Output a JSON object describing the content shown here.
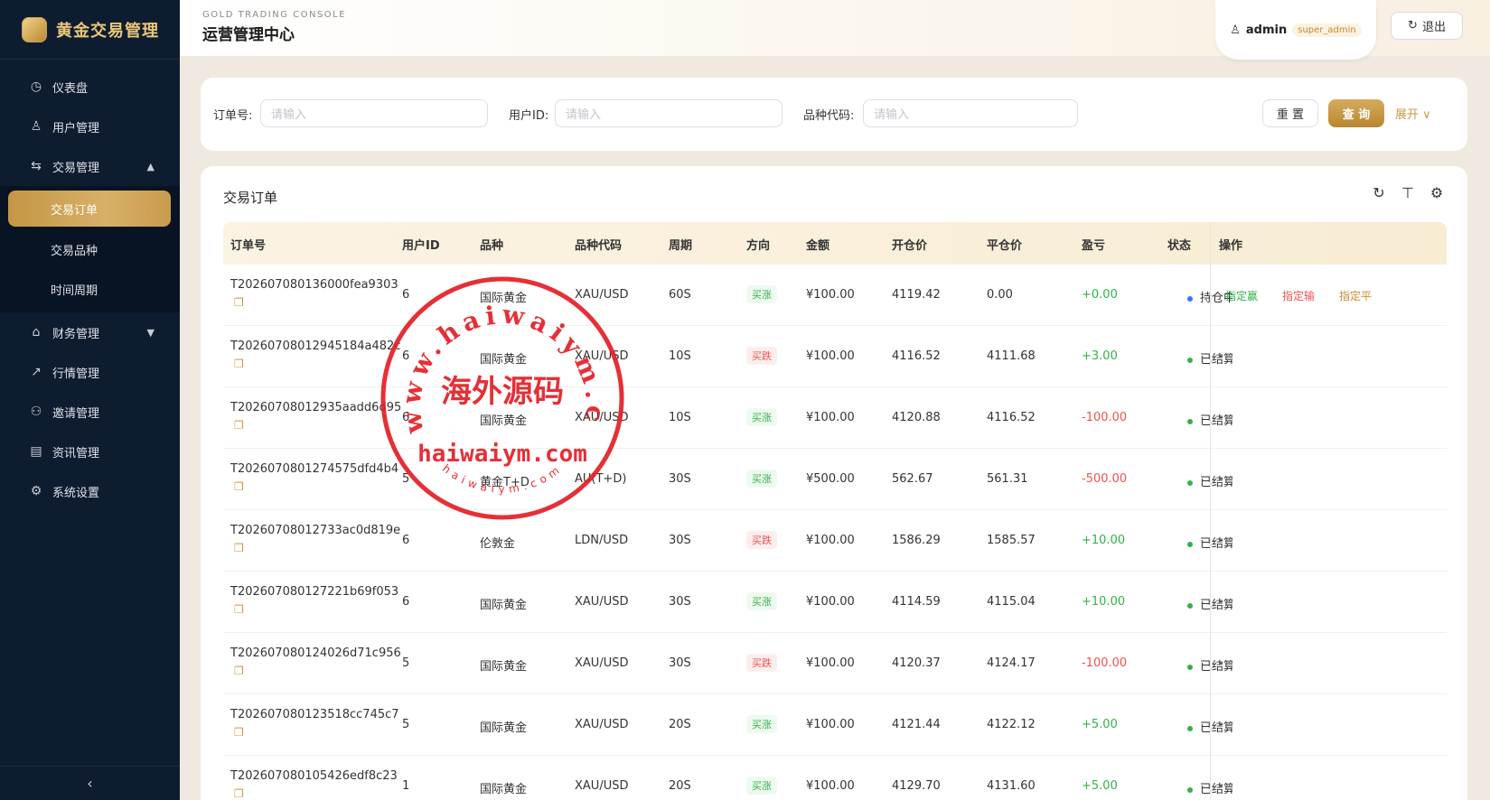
{
  "brand": {
    "title": "黄金交易管理"
  },
  "sidebar": {
    "items": [
      {
        "label": "仪表盘",
        "icon": "dashboard-icon"
      },
      {
        "label": "用户管理",
        "icon": "user-icon"
      },
      {
        "label": "交易管理",
        "icon": "exchange-icon",
        "expanded": true
      },
      {
        "label": "财务管理",
        "icon": "bank-icon",
        "expanded": false
      },
      {
        "label": "行情管理",
        "icon": "line-chart-icon"
      },
      {
        "label": "邀请管理",
        "icon": "invite-icon"
      },
      {
        "label": "资讯管理",
        "icon": "document-icon"
      },
      {
        "label": "系统设置",
        "icon": "gear-icon"
      }
    ],
    "trade_sub": [
      {
        "label": "交易订单",
        "active": true
      },
      {
        "label": "交易品种",
        "active": false
      },
      {
        "label": "时间周期",
        "active": false
      }
    ]
  },
  "header": {
    "subtitle": "GOLD TRADING CONSOLE",
    "title": "运营管理中心",
    "username": "admin",
    "role": "super_admin",
    "logout": "退出"
  },
  "filter": {
    "order_label": "订单号:",
    "user_label": "用户ID:",
    "symbol_label": "品种代码:",
    "placeholder": "请输入",
    "reset": "重 置",
    "query": "查 询",
    "expand": "展开"
  },
  "table": {
    "title": "交易订单",
    "columns": [
      "订单号",
      "用户ID",
      "品种",
      "品种代码",
      "周期",
      "方向",
      "金额",
      "开仓价",
      "平仓价",
      "盈亏",
      "状态",
      "操作"
    ],
    "actions": {
      "win": "指定赢",
      "lose": "指定输",
      "flat": "指定平"
    },
    "rows": [
      {
        "order": "T202607080136000fea9303",
        "user": "6",
        "name": "国际黄金",
        "code": "XAU/USD",
        "period": "60S",
        "dir": "买涨",
        "amount": "¥100.00",
        "open": "4119.42",
        "close": "0.00",
        "pnl": "+0.00",
        "status": "持仓中",
        "op": ""
      },
      {
        "order": "T20260708012945184a482c",
        "user": "6",
        "name": "国际黄金",
        "code": "XAU/USD",
        "period": "10S",
        "dir": "买跌",
        "amount": "¥100.00",
        "open": "4116.52",
        "close": "4111.68",
        "pnl": "+3.00",
        "status": "已结算",
        "op": "-"
      },
      {
        "order": "T20260708012935aadd6d95",
        "user": "6",
        "name": "国际黄金",
        "code": "XAU/USD",
        "period": "10S",
        "dir": "买涨",
        "amount": "¥100.00",
        "open": "4120.88",
        "close": "4116.52",
        "pnl": "-100.00",
        "status": "已结算",
        "op": "-"
      },
      {
        "order": "T2026070801274575dfd4b4",
        "user": "5",
        "name": "黄金T+D",
        "code": "AU(T+D)",
        "period": "30S",
        "dir": "买涨",
        "amount": "¥500.00",
        "open": "562.67",
        "close": "561.31",
        "pnl": "-500.00",
        "status": "已结算",
        "op": "-"
      },
      {
        "order": "T20260708012733ac0d819e",
        "user": "6",
        "name": "伦敦金",
        "code": "LDN/USD",
        "period": "30S",
        "dir": "买跌",
        "amount": "¥100.00",
        "open": "1586.29",
        "close": "1585.57",
        "pnl": "+10.00",
        "status": "已结算",
        "op": "-"
      },
      {
        "order": "T202607080127221b69f053",
        "user": "6",
        "name": "国际黄金",
        "code": "XAU/USD",
        "period": "30S",
        "dir": "买涨",
        "amount": "¥100.00",
        "open": "4114.59",
        "close": "4115.04",
        "pnl": "+10.00",
        "status": "已结算",
        "op": "-"
      },
      {
        "order": "T202607080124026d71c956",
        "user": "5",
        "name": "国际黄金",
        "code": "XAU/USD",
        "period": "30S",
        "dir": "买跌",
        "amount": "¥100.00",
        "open": "4120.37",
        "close": "4124.17",
        "pnl": "-100.00",
        "status": "已结算",
        "op": "-"
      },
      {
        "order": "T202607080123518cc745c7",
        "user": "5",
        "name": "国际黄金",
        "code": "XAU/USD",
        "period": "20S",
        "dir": "买涨",
        "amount": "¥100.00",
        "open": "4121.44",
        "close": "4122.12",
        "pnl": "+5.00",
        "status": "已结算",
        "op": "-"
      },
      {
        "order": "T202607080105426edf8c23",
        "user": "1",
        "name": "国际黄金",
        "code": "XAU/USD",
        "period": "20S",
        "dir": "买涨",
        "amount": "¥100.00",
        "open": "4129.70",
        "close": "4131.60",
        "pnl": "+5.00",
        "status": "已结算",
        "op": "-"
      }
    ]
  },
  "watermark": {
    "arc_text": "www.haiwaiym.com",
    "center_text": "海外源码",
    "domain_text": "haiwaiym.com",
    "small_text": "haiwaiym.com"
  },
  "colors": {
    "sidebar_bg": "#0e1c2f",
    "gold_accent": "#c89b45",
    "profit_green": "#33b249",
    "loss_red": "#f0524f",
    "stamp_red": "#e41e26"
  }
}
